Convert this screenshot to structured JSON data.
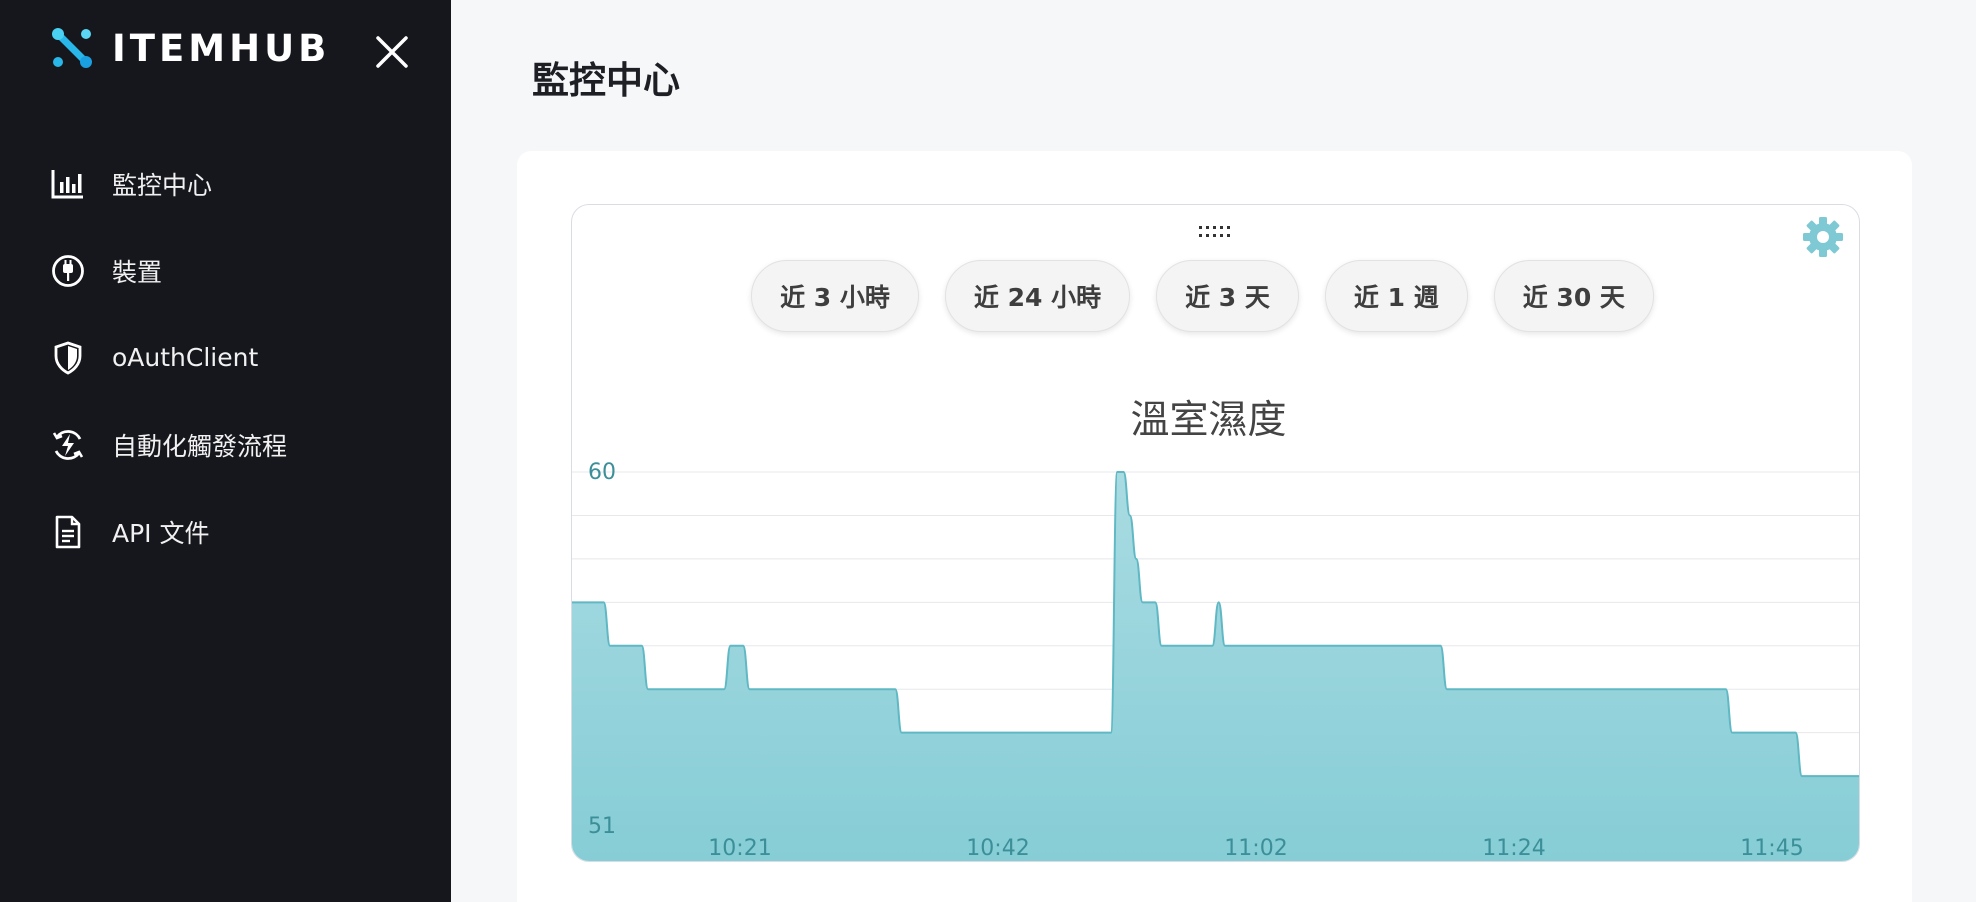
{
  "sidebar": {
    "brand": "ITEMHUB",
    "items": [
      {
        "label": "監控中心",
        "icon": "bar-chart-icon"
      },
      {
        "label": "裝置",
        "icon": "plug-icon"
      },
      {
        "label": "oAuthClient",
        "icon": "shield-icon"
      },
      {
        "label": "自動化觸發流程",
        "icon": "lightning-cycle-icon"
      },
      {
        "label": "API 文件",
        "icon": "document-icon"
      }
    ]
  },
  "main": {
    "title": "監控中心",
    "ranges": [
      "近 3 小時",
      "近 24 小時",
      "近 3 天",
      "近 1 週",
      "近 30 天"
    ]
  },
  "colors": {
    "sidebar_bg": "#16171d",
    "accent": "#7ec9d3",
    "line": "#5fb8c3",
    "axis_text": "#3c8f98"
  },
  "chart_data": {
    "type": "area",
    "title": "溫室濕度",
    "xlabel": "",
    "ylabel": "",
    "ylim": [
      51,
      60
    ],
    "y_ticks": [
      "60",
      "51"
    ],
    "x_ticks": [
      "10:21",
      "10:42",
      "11:02",
      "11:24",
      "11:45"
    ],
    "grid": true,
    "legend": "none",
    "series": [
      {
        "values": [
          57,
          57,
          57,
          57,
          57,
          57,
          56,
          56,
          56,
          56,
          56,
          56,
          55,
          55,
          55,
          55,
          55,
          55,
          55,
          55,
          55,
          55,
          55,
          55,
          55,
          56,
          56,
          56,
          55,
          55,
          55,
          55,
          55,
          55,
          55,
          55,
          55,
          55,
          55,
          55,
          55,
          55,
          55,
          55,
          55,
          55,
          55,
          55,
          55,
          55,
          55,
          55,
          54,
          54,
          54,
          54,
          54,
          54,
          54,
          54,
          54,
          54,
          54,
          54,
          54,
          54,
          54,
          54,
          54,
          54,
          54,
          54,
          54,
          54,
          54,
          54,
          54,
          54,
          54,
          54,
          54,
          54,
          54,
          54,
          54,
          54,
          60,
          60,
          59,
          58,
          57,
          57,
          57,
          56,
          56,
          56,
          56,
          56,
          56,
          56,
          56,
          56,
          57,
          56,
          56,
          56,
          56,
          56,
          56,
          56,
          56,
          56,
          56,
          56,
          56,
          56,
          56,
          56,
          56,
          56,
          56,
          56,
          56,
          56,
          56,
          56,
          56,
          56,
          56,
          56,
          56,
          56,
          56,
          56,
          56,
          56,
          56,
          56,
          55,
          55,
          55,
          55,
          55,
          55,
          55,
          55,
          55,
          55,
          55,
          55,
          55,
          55,
          55,
          55,
          55,
          55,
          55,
          55,
          55,
          55,
          55,
          55,
          55,
          55,
          55,
          55,
          55,
          55,
          55,
          55,
          55,
          55,
          55,
          55,
          55,
          55,
          55,
          55,
          55,
          55,
          55,
          55,
          55,
          54,
          54,
          54,
          54,
          54,
          54,
          54,
          54,
          54,
          54,
          54,
          53,
          53,
          53,
          53,
          53,
          53,
          53,
          53,
          53,
          53
        ]
      }
    ]
  }
}
